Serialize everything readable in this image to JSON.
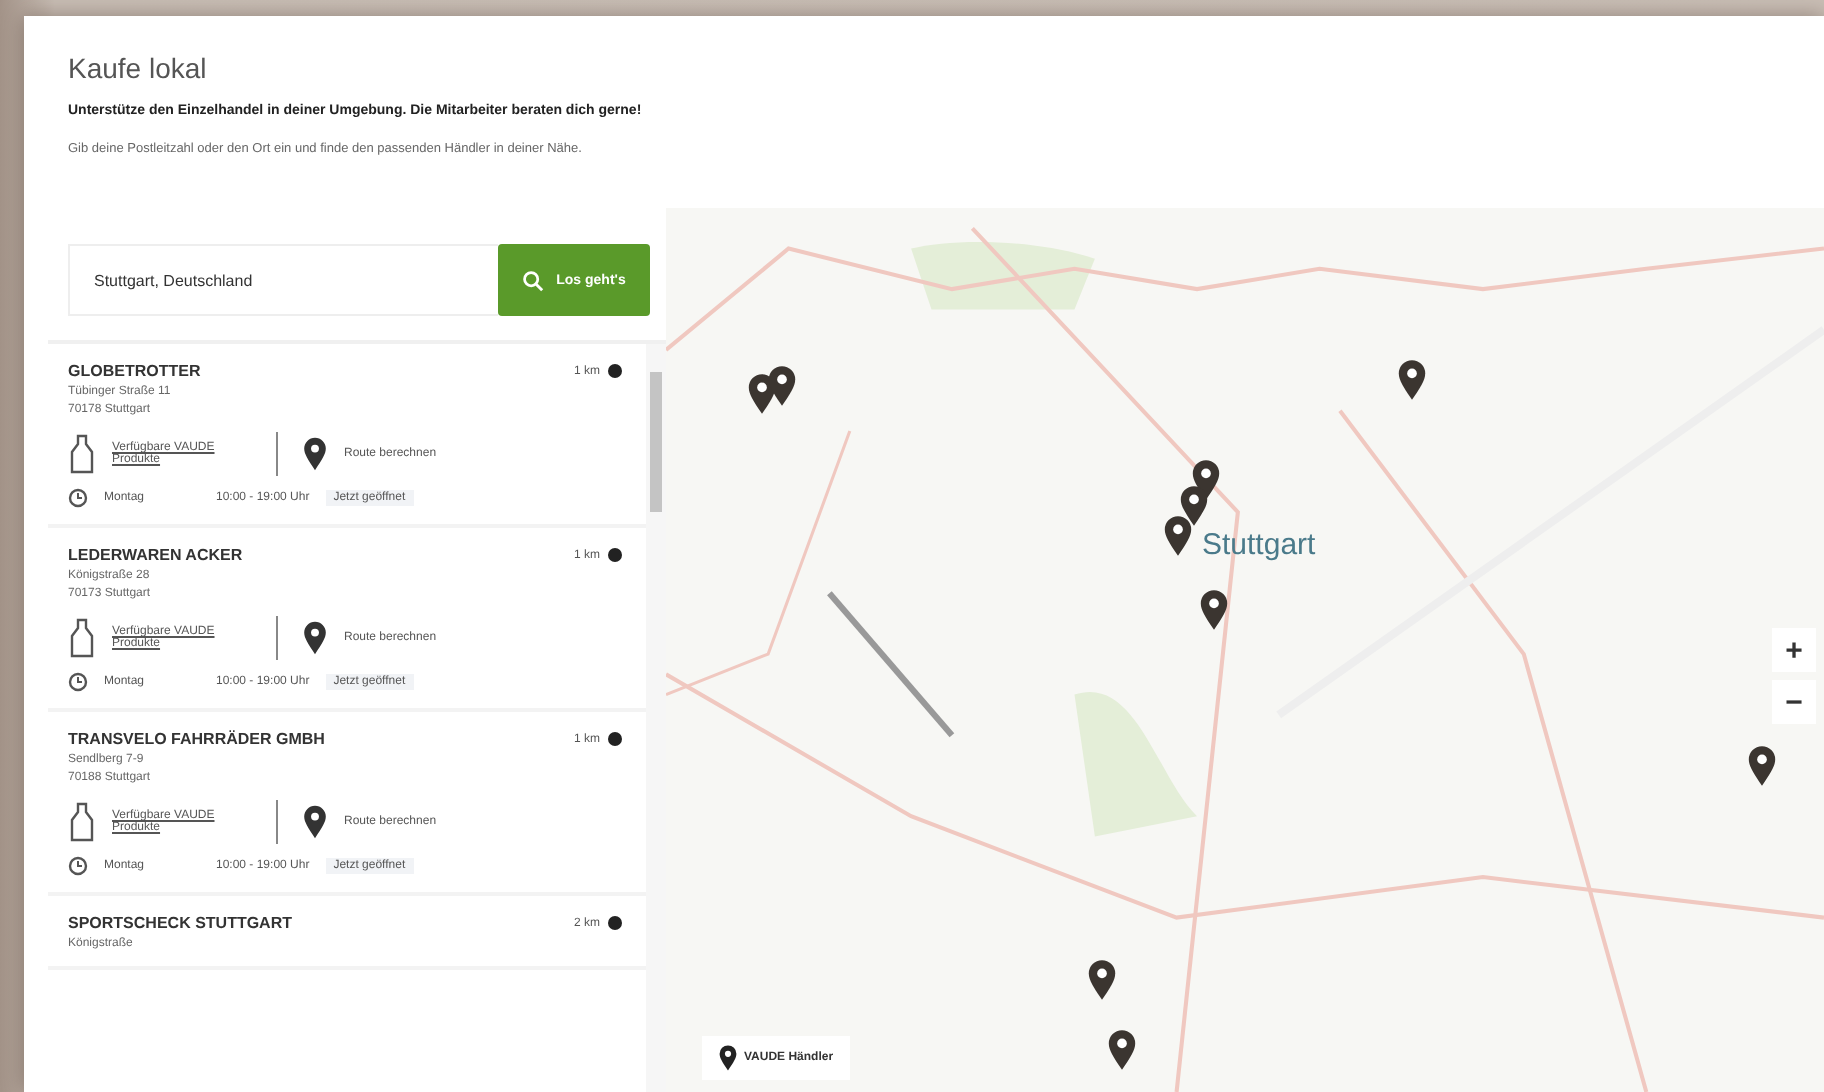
{
  "page": {
    "title": "Kaufe lokal",
    "lead": "Unterstütze den Einzelhandel in deiner Umgebung. Die Mitarbeiter beraten dich gerne!",
    "hint": "Gib deine Postleitzahl oder den Ort ein und finde den passenden Händler in deiner Nähe."
  },
  "search": {
    "value": "Stuttgart, Deutschland",
    "button": "Los geht's"
  },
  "stores": [
    {
      "name": "GLOBETROTTER",
      "street": "Tübinger Straße 11",
      "city": "70178 Stuttgart",
      "distance": "1 km",
      "products_link": "Verfügbare VAUDE Produkte",
      "route_link": "Route berechnen",
      "day": "Montag",
      "hours": "10:00 - 19:00 Uhr",
      "status": "Jetzt geöffnet"
    },
    {
      "name": "LEDERWAREN ACKER",
      "street": "Königstraße 28",
      "city": "70173 Stuttgart",
      "distance": "1 km",
      "products_link": "Verfügbare VAUDE Produkte",
      "route_link": "Route berechnen",
      "day": "Montag",
      "hours": "10:00 - 19:00 Uhr",
      "status": "Jetzt geöffnet"
    },
    {
      "name": "TRANSVELO FAHRRÄDER GMBH",
      "street": "Sendlberg 7-9",
      "city": "70188 Stuttgart",
      "distance": "1 km",
      "products_link": "Verfügbare VAUDE Produkte",
      "route_link": "Route berechnen",
      "day": "Montag",
      "hours": "10:00 - 19:00 Uhr",
      "status": "Jetzt geöffnet"
    },
    {
      "name": "SPORTSCHECK STUTTGART",
      "street": "Königstraße",
      "distance": "2 km"
    }
  ],
  "map": {
    "kind": "picture",
    "city_label": "Stuttgart",
    "zoom_in": "+",
    "zoom_out": "−",
    "legend": "VAUDE Händler"
  }
}
